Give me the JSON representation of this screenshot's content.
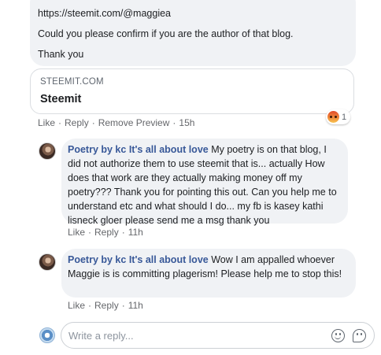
{
  "top_message": {
    "link": "https://steemit.com/@maggiea",
    "confirm_text": "Could you please confirm if you are the author of that blog.",
    "thanks_text": "Thank you"
  },
  "link_preview": {
    "domain": "STEEMIT.COM",
    "title": "Steemit"
  },
  "reaction": {
    "icon": "angry-reaction-icon",
    "count": "1"
  },
  "actions_1": {
    "like": "Like",
    "reply": "Reply",
    "remove_preview": "Remove Preview",
    "time": "15h",
    "sep": "·"
  },
  "comments": [
    {
      "author": "Poetry by kc It's all about love",
      "text": " My poetry is on that blog, I did not authorize them to use steemit that is... actually How does that work are they actually making money off my poetry??? Thank you for pointing this out. Can you help me to understand etc and what should I do... my fb is kasey kathi lisneck gloer please send me a msg thank you",
      "like": "Like",
      "reply": "Reply",
      "time": "11h",
      "sep": "·"
    },
    {
      "author": "Poetry by kc It's all about love",
      "text": " Wow I am appalled whoever Maggie is is committing plagerism! Please help me to stop this!",
      "like": "Like",
      "reply": "Reply",
      "time": "11h",
      "sep": "·"
    }
  ],
  "reply_box": {
    "placeholder": "Write a reply...",
    "icons": [
      "emoji-icon",
      "sticker-icon"
    ]
  },
  "colors": {
    "bubble": "#f0f2f5",
    "author": "#385898",
    "meta": "#65676b"
  }
}
